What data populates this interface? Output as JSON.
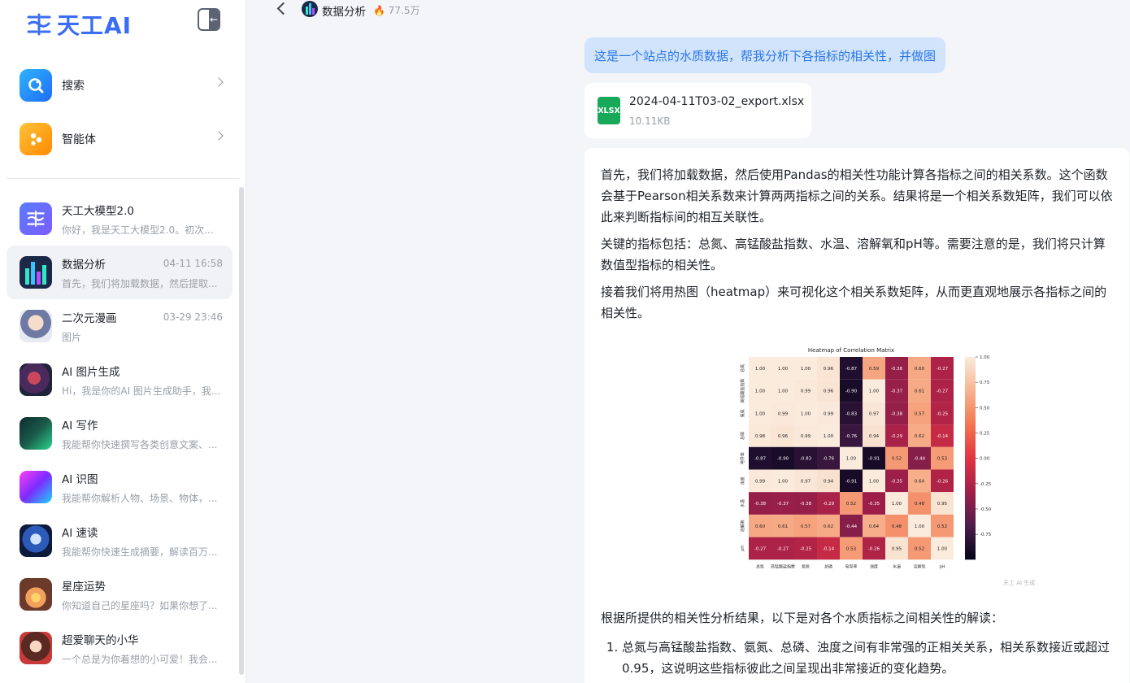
{
  "brand": {
    "name": "天工AI"
  },
  "nav": [
    {
      "label": "搜索",
      "icon": "search-icon"
    },
    {
      "label": "智能体",
      "icon": "agent-icon"
    }
  ],
  "chats": [
    {
      "title": "天工大模型2.0",
      "subtitle": "你好，我是天工大模型2.0。初次...",
      "time": ""
    },
    {
      "title": "数据分析",
      "subtitle": "首先，我们将加载数据，然后提取...",
      "time": "04-11 16:58"
    },
    {
      "title": "二次元漫画",
      "subtitle": "图片",
      "time": "03-29 23:46"
    },
    {
      "title": "AI 图片生成",
      "subtitle": "Hi，我是你的AI 图片生成助手，我...",
      "time": ""
    },
    {
      "title": "AI 写作",
      "subtitle": "我能帮你快速撰写各类创意文案、...",
      "time": ""
    },
    {
      "title": "AI 识图",
      "subtitle": "我能帮你解析人物、场景、物体，...",
      "time": ""
    },
    {
      "title": "AI 速读",
      "subtitle": "我能帮你快速生成摘要，解读百万...",
      "time": ""
    },
    {
      "title": "星座运势",
      "subtitle": "你知道自己的星座吗？如果你想了...",
      "time": ""
    },
    {
      "title": "超爱聊天的小华",
      "subtitle": "一个总是为你着想的小可爱！我会...",
      "time": ""
    }
  ],
  "header": {
    "title": "数据分析",
    "hot": "77.5万"
  },
  "user_message": "这是一个站点的水质数据，帮我分析下各指标的相关性，并做图",
  "file": {
    "name": "2024-04-11T03-02_export.xlsx",
    "size": "10.11KB",
    "type": "XLSX"
  },
  "answer": {
    "p1": "首先，我们将加载数据，然后使用Pandas的相关性功能计算各指标之间的相关系数。这个函数会基于Pearson相关系数来计算两两指标之间的关系。结果将是一个相关系数矩阵，我们可以依此来判断指标间的相互关联性。",
    "p2": "关键的指标包括：总氮、高锰酸盐指数、水温、溶解氧和pH等。需要注意的是，我们将只计算数值型指标的相关性。",
    "p3": "接着我们将用热图（heatmap）来可视化这个相关系数矩阵，从而更直观地展示各指标之间的相关性。",
    "p4": "根据所提供的相关性分析结果，以下是对各个水质指标之间相关性的解读：",
    "list": [
      "总氮与高锰酸盐指数、氨氮、总磷、浊度之间有非常强的正相关关系，相关系数接近或超过0.95，这说明这些指标彼此之间呈现出非常接近的变化趋势。"
    ],
    "watermark": "天工 AI 生成"
  },
  "chart_data": {
    "type": "heatmap",
    "title": "Heatmap of Correlation Matrix",
    "labels": [
      "总氮",
      "高锰酸盐指数",
      "氨氮",
      "总磷",
      "电导率",
      "浊度",
      "水温",
      "溶解氧",
      "pH"
    ],
    "colorbar_ticks": [
      1.0,
      0.75,
      0.5,
      0.25,
      0.0,
      -0.25,
      -0.5,
      -0.75
    ],
    "range": [
      -1,
      1
    ],
    "matrix": [
      [
        1.0,
        1.0,
        1.0,
        0.96,
        -0.87,
        0.59,
        -0.38,
        0.6,
        -0.27
      ],
      [
        1.0,
        1.0,
        0.99,
        0.96,
        -0.9,
        1.0,
        -0.37,
        0.61,
        -0.27
      ],
      [
        1.0,
        0.99,
        1.0,
        0.99,
        -0.83,
        0.97,
        -0.38,
        0.57,
        -0.25
      ],
      [
        0.98,
        0.96,
        0.99,
        1.0,
        -0.76,
        0.94,
        -0.29,
        0.62,
        -0.14
      ],
      [
        -0.87,
        -0.9,
        -0.83,
        -0.76,
        1.0,
        -0.91,
        0.52,
        -0.44,
        0.53
      ],
      [
        0.99,
        1.0,
        0.97,
        0.94,
        -0.91,
        1.0,
        -0.35,
        0.64,
        -0.26
      ],
      [
        -0.38,
        -0.37,
        -0.38,
        -0.29,
        0.52,
        -0.35,
        1.0,
        0.48,
        0.95
      ],
      [
        0.6,
        0.61,
        0.57,
        0.62,
        -0.44,
        0.64,
        0.48,
        1.0,
        0.52
      ],
      [
        -0.27,
        -0.27,
        -0.25,
        -0.14,
        0.53,
        -0.26,
        0.95,
        0.52,
        1.0
      ]
    ],
    "colormap": "rocket"
  }
}
